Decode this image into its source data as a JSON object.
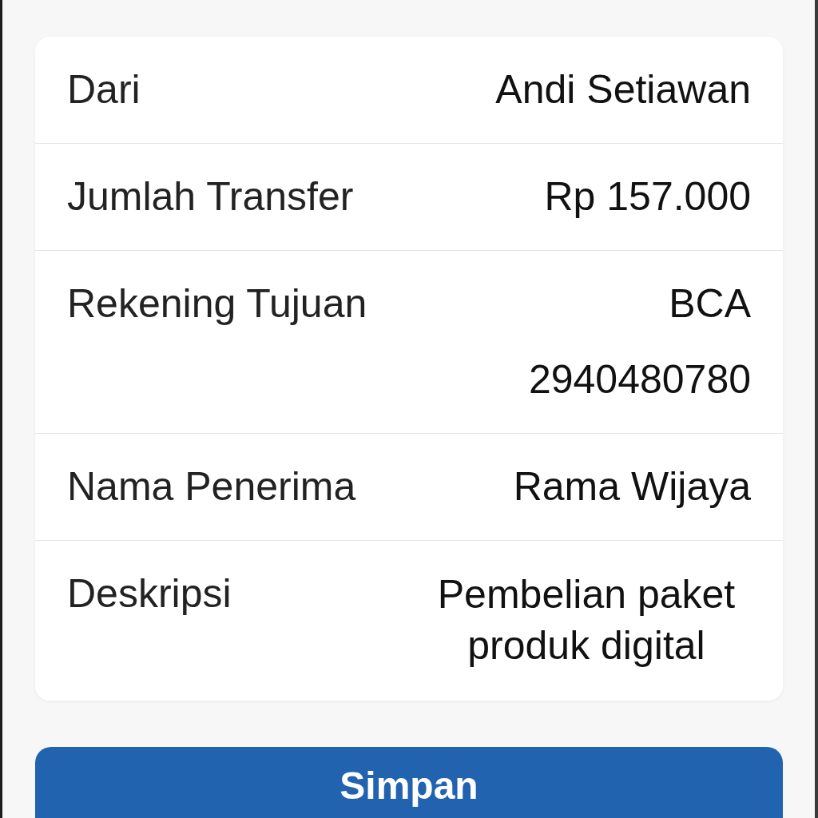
{
  "rows": [
    {
      "kind": "single",
      "label": "Dari",
      "value": "Andi Setiawan"
    },
    {
      "kind": "single",
      "label": "Jumlah Transfer",
      "value": "Rp 157.000"
    },
    {
      "kind": "stacked",
      "label": "Rekening Tujuan",
      "values": [
        "BCA",
        "2940480780"
      ]
    },
    {
      "kind": "single",
      "label": "Nama Penerima",
      "value": "Rama Wijaya"
    },
    {
      "kind": "wrapped",
      "label": "Deskripsi",
      "value": "Pembelian paket produk digital"
    }
  ],
  "button": {
    "label": "Simpan"
  }
}
